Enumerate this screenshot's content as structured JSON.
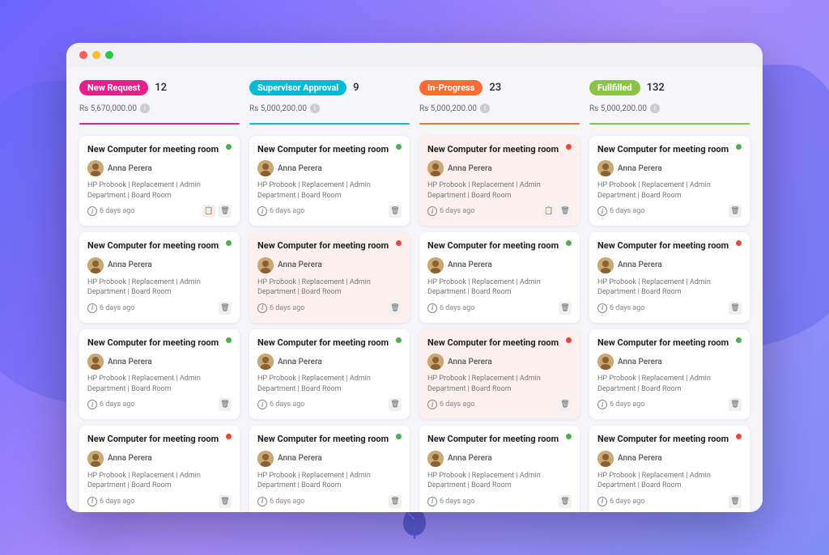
{
  "background": {
    "gradient_start": "#6c63ff",
    "gradient_end": "#818cf8"
  },
  "browser": {
    "dots": [
      "#ff5f57",
      "#febc2e",
      "#28c840"
    ]
  },
  "columns": [
    {
      "id": "new-request",
      "badge_label": "New Request",
      "badge_class": "badge-new",
      "divider_class": "divider-new",
      "count": "12",
      "amount": "Rs 5,670,000.00",
      "cards": [
        {
          "title": "New Computer for meeting room",
          "dot": "green",
          "user": "Anna Perera",
          "meta": "HP Probook | Replacement | Admin Department | Board Room",
          "time": "6 days ago",
          "bg": "",
          "actions": [
            "copy",
            "delete"
          ]
        },
        {
          "title": "New Computer for meeting room",
          "dot": "green",
          "user": "Anna Perera",
          "meta": "HP Probook | Replacement | Admin Department | Board Room",
          "time": "6 days ago",
          "bg": "",
          "actions": [
            "delete"
          ]
        },
        {
          "title": "New Computer for meeting room",
          "dot": "green",
          "user": "Anna Perera",
          "meta": "HP Probook | Replacement | Admin Department | Board Room",
          "time": "6 days ago",
          "bg": "",
          "actions": [
            "delete"
          ]
        },
        {
          "title": "New Computer for meeting room",
          "dot": "red",
          "user": "Anna Perera",
          "meta": "HP Probook | Replacement | Admin Department | Board Room",
          "time": "6 days ago",
          "bg": "",
          "actions": [
            "delete"
          ]
        }
      ]
    },
    {
      "id": "supervisor-approval",
      "badge_label": "Supervisor Approval",
      "badge_class": "badge-supervisor",
      "divider_class": "divider-supervisor",
      "count": "9",
      "amount": "Rs 5,000,200.00",
      "cards": [
        {
          "title": "New Computer for meeting room",
          "dot": "green",
          "user": "Anna Perera",
          "meta": "HP Probook | Replacement | Admin Department | Board Room",
          "time": "6 days ago",
          "bg": "",
          "actions": [
            "delete"
          ]
        },
        {
          "title": "New Computer for meeting room",
          "dot": "red",
          "user": "Anna Perera",
          "meta": "HP Probook | Replacement | Admin Department | Board Room",
          "time": "6 days ago",
          "bg": "card-pink",
          "actions": [
            "delete"
          ]
        },
        {
          "title": "New Computer for meeting room",
          "dot": "green",
          "user": "Anna Perera",
          "meta": "HP Probook | Replacement | Admin Department | Board Room",
          "time": "6 days ago",
          "bg": "",
          "actions": [
            "delete"
          ]
        },
        {
          "title": "New Computer for meeting room",
          "dot": "green",
          "user": "Anna Perera",
          "meta": "HP Probook | Replacement | Admin Department | Board Room",
          "time": "6 days ago",
          "bg": "",
          "actions": [
            "delete"
          ]
        }
      ]
    },
    {
      "id": "in-progress",
      "badge_label": "In-Progress",
      "badge_class": "badge-inprogress",
      "divider_class": "divider-inprogress",
      "count": "23",
      "amount": "Rs 5,000,200.00",
      "cards": [
        {
          "title": "New Computer for meeting room",
          "dot": "red",
          "user": "Anna Perera",
          "meta": "HP Probook | Replacement | Admin Department | Board Room",
          "time": "6 days ago",
          "bg": "card-pink",
          "actions": [
            "copy",
            "delete"
          ]
        },
        {
          "title": "New Computer for meeting room",
          "dot": "green",
          "user": "Anna Perera",
          "meta": "HP Probook | Replacement | Admin Department | Board Room",
          "time": "6 days ago",
          "bg": "",
          "actions": [
            "delete"
          ]
        },
        {
          "title": "New Computer for meeting room",
          "dot": "red",
          "user": "Anna Perera",
          "meta": "HP Probook | Replacement | Admin Department | Board Room",
          "time": "6 days ago",
          "bg": "card-pink",
          "actions": [
            "delete"
          ]
        },
        {
          "title": "New Computer for meeting room",
          "dot": "green",
          "user": "Anna Perera",
          "meta": "HP Probook | Replacement | Admin Department | Board Room",
          "time": "6 days ago",
          "bg": "",
          "actions": [
            "delete"
          ]
        }
      ]
    },
    {
      "id": "fulfilled",
      "badge_label": "Fullfilled",
      "badge_class": "badge-fulfilled",
      "divider_class": "divider-fulfilled",
      "count": "132",
      "amount": "Rs 5,000,200.00",
      "cards": [
        {
          "title": "New Computer for meeting room",
          "dot": "green",
          "user": "Anna Perera",
          "meta": "HP Probook | Replacement | Admin Department | Board Room",
          "time": "6 days ago",
          "bg": "",
          "actions": [
            "delete"
          ]
        },
        {
          "title": "New Computer for meeting room",
          "dot": "red",
          "user": "Anna Perera",
          "meta": "HP Probook | Replacement | Admin Department | Board Room",
          "time": "6 days ago",
          "bg": "",
          "actions": [
            "delete"
          ]
        },
        {
          "title": "New Computer for meeting room",
          "dot": "green",
          "user": "Anna Perera",
          "meta": "HP Probook | Replacement | Admin Department | Board Room",
          "time": "6 days ago",
          "bg": "",
          "actions": [
            "delete"
          ]
        },
        {
          "title": "New Computer for meeting room",
          "dot": "red",
          "user": "Anna Perera",
          "meta": "HP Probook | Replacement | Admin Department | Board Room",
          "time": "6 days ago",
          "bg": "",
          "actions": [
            "delete"
          ]
        }
      ]
    }
  ]
}
